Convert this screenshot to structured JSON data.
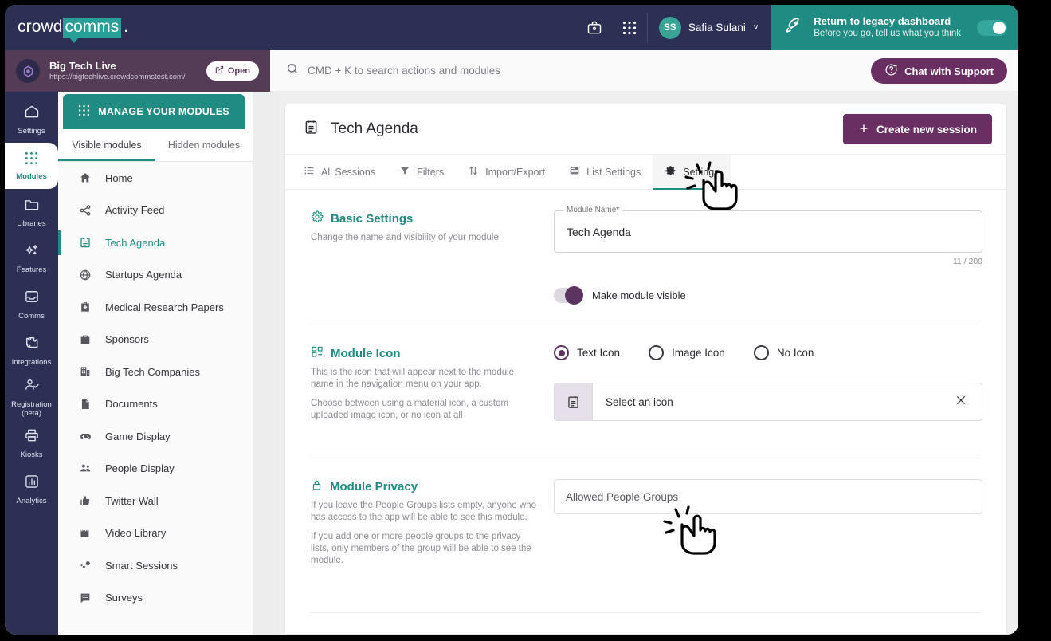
{
  "brand": {
    "part1": "crowd",
    "part2": "comms",
    "part3": "."
  },
  "topbar": {
    "briefcase_icon": "briefcase-icon",
    "apps_icon": "apps-grid-icon",
    "avatar_initials": "SS",
    "user_name": "Safia Sulani",
    "caret": "∨",
    "legacy_title": "Return to legacy dashboard",
    "legacy_sub_prefix": "Before you go, ",
    "legacy_sub_link": "tell us what you think",
    "rocket_icon": "rocket-icon"
  },
  "eventbar": {
    "name": "Big Tech Live",
    "url": "https://bigtechlive.crowdcommstest.com/",
    "open_label": "Open",
    "open_icon": "external-link-icon"
  },
  "search": {
    "placeholder": "CMD + K to search actions and modules",
    "icon": "search-icon"
  },
  "support": {
    "label": "Chat with Support",
    "icon": "question-circle-icon"
  },
  "rail": {
    "items": [
      {
        "label": "Settings",
        "icon": "home-icon",
        "active": false
      },
      {
        "label": "Modules",
        "icon": "apps-grid-icon",
        "active": true
      },
      {
        "label": "Libraries",
        "icon": "folder-icon",
        "active": false
      },
      {
        "label": "Features",
        "icon": "sparkle-icon",
        "active": false
      },
      {
        "label": "Comms",
        "icon": "inbox-icon",
        "active": false
      },
      {
        "label": "Integrations",
        "icon": "puzzle-icon",
        "active": false
      },
      {
        "label": "Registration (beta)",
        "icon": "person-check-icon",
        "active": false
      },
      {
        "label": "Kiosks",
        "icon": "printer-icon",
        "active": false
      },
      {
        "label": "Analytics",
        "icon": "chart-icon",
        "active": false
      }
    ]
  },
  "modules_panel": {
    "manage_label": "MANAGE YOUR MODULES",
    "manage_icon": "apps-grid-icon",
    "tabs": [
      {
        "label": "Visible modules",
        "active": true
      },
      {
        "label": "Hidden modules",
        "active": false
      }
    ],
    "items": [
      {
        "label": "Home",
        "icon": "home-filled-icon",
        "selected": false
      },
      {
        "label": "Activity Feed",
        "icon": "share-icon",
        "selected": false
      },
      {
        "label": "Tech Agenda",
        "icon": "agenda-icon",
        "selected": true
      },
      {
        "label": "Startups Agenda",
        "icon": "globe-icon",
        "selected": false
      },
      {
        "label": "Medical Research Papers",
        "icon": "medical-bag-icon",
        "selected": false
      },
      {
        "label": "Sponsors",
        "icon": "briefcase-icon",
        "selected": false
      },
      {
        "label": "Big Tech Companies",
        "icon": "building-icon",
        "selected": false
      },
      {
        "label": "Documents",
        "icon": "document-icon",
        "selected": false
      },
      {
        "label": "Game Display",
        "icon": "gamepad-icon",
        "selected": false
      },
      {
        "label": "People Display",
        "icon": "people-icon",
        "selected": false
      },
      {
        "label": "Twitter Wall",
        "icon": "thumbs-up-icon",
        "selected": false
      },
      {
        "label": "Video Library",
        "icon": "clapperboard-icon",
        "selected": false
      },
      {
        "label": "Smart Sessions",
        "icon": "bubbles-icon",
        "selected": false
      },
      {
        "label": "Surveys",
        "icon": "survey-icon",
        "selected": false
      }
    ]
  },
  "page": {
    "title": "Tech Agenda",
    "title_icon": "agenda-icon",
    "create_label": "Create new session",
    "create_icon": "plus-icon",
    "tabs": [
      {
        "label": "All Sessions",
        "icon": "list-icon",
        "active": false
      },
      {
        "label": "Filters",
        "icon": "funnel-icon",
        "active": false
      },
      {
        "label": "Import/Export",
        "icon": "sort-arrows-icon",
        "active": false
      },
      {
        "label": "List Settings",
        "icon": "list-settings-icon",
        "active": false
      },
      {
        "label": "Settings",
        "icon": "gear-icon",
        "active": true
      }
    ]
  },
  "basic_settings": {
    "heading": "Basic Settings",
    "heading_icon": "gear-icon",
    "description": "Change the name and visibility of your module",
    "field_label": "Module Name",
    "field_required_mark": "*",
    "field_value": "Tech Agenda",
    "counter": "11 / 200",
    "toggle_label": "Make module visible",
    "toggle_on": true
  },
  "module_icon": {
    "heading": "Module Icon",
    "heading_icon": "module-icon-icon",
    "description_1": "This is the icon that will appear next to the module name in the navigation menu on your app.",
    "description_2": "Choose between using a material icon, a custom uploaded image icon, or no icon at all",
    "options": [
      {
        "label": "Text Icon",
        "selected": true
      },
      {
        "label": "Image Icon",
        "selected": false
      },
      {
        "label": "No Icon",
        "selected": false
      }
    ],
    "select_placeholder": "Select an icon",
    "select_icon": "agenda-icon",
    "clear_icon": "close-icon"
  },
  "module_privacy": {
    "heading": "Module Privacy",
    "heading_icon": "lock-icon",
    "description_1": "If you leave the People Groups lists empty, anyone who has access to the app will be able to see this module.",
    "description_2": "If you add one or more people groups to the privacy lists, only members of the group will be able to see the module.",
    "field_placeholder": "Allowed People Groups"
  },
  "colors": {
    "navy": "#2b3054",
    "teal": "#1f8b82",
    "purple": "#6a2f62",
    "plum": "#543c57",
    "gray_bg": "#efefef"
  }
}
